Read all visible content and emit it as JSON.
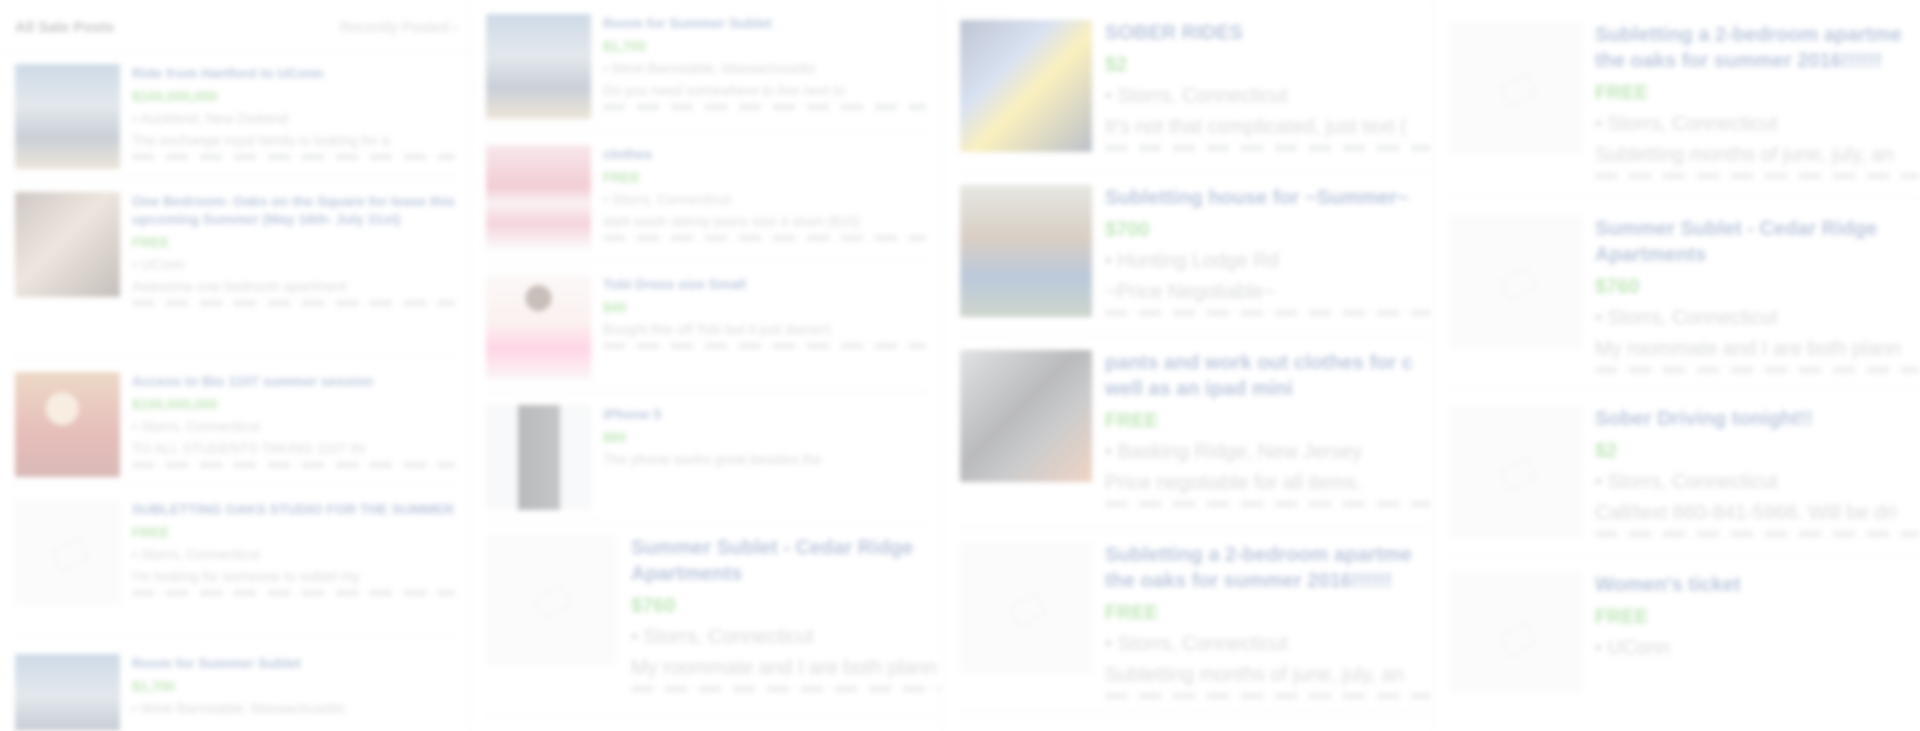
{
  "header": {
    "title": "All Sale Posts",
    "sort_label": "Recently Posted ›"
  },
  "columns": [
    {
      "posts": [
        {
          "title": "Ride from Hartford to UConn",
          "price": "$100,000,000",
          "location": "• Auckland, New Zealand",
          "description": "The exchange royal family is looking for a",
          "image": "img-people"
        },
        {
          "title": "One Bedroom- Oaks on the Square for lease this upcoming Summer (May 16th- July 31st)",
          "price": "FREE",
          "location": "• UConn",
          "description": "Awesome one bedroom apartment",
          "image": "img-room"
        },
        {
          "title": "Access to Bio 1107 summer session",
          "price": "$100,000,000",
          "location": "• Storrs, Connecticut",
          "description": "TO ALL STUDENTS TAKING 1107 IN",
          "image": "img-man"
        },
        {
          "title": "SUBLETTING OAKS STUDIO FOR THE SUMMER",
          "price": "FREE",
          "location": "• Storrs, Connecticut",
          "description": "I'm looking for someone to sublet my",
          "image": ""
        },
        {
          "title": "Room for Summer Sublet",
          "price": "$1,700",
          "location": "• West Barnstable, Massachusetts",
          "description": "",
          "image": "img-people"
        }
      ]
    },
    {
      "posts": [
        {
          "title": "Room for Summer Sublet",
          "price": "$1,700",
          "location": "• West Barnstable, Massachusetts",
          "description": "Do you need somewhere to live next to",
          "image": "img-people"
        },
        {
          "title": "clothes",
          "price": "FREE",
          "location": "• Storrs, Connecticut",
          "description": "dark wash skinny jeans size 4 short ($10)",
          "image": "img-sweater"
        },
        {
          "title": "Tobi Dress size Small",
          "price": "$40",
          "location": "",
          "description": "Bought this off Tobi but it just doesn't",
          "image": "img-dress"
        },
        {
          "title": "iPhone 5",
          "price": "$80",
          "location": "",
          "description": "The phone works great besides the",
          "image": "img-phone"
        },
        {
          "title": "Summer Sublet - Cedar Ridge Apartments",
          "price": "$760",
          "location": "• Storrs, Connecticut",
          "description": "My roommate and I are both plann",
          "image": ""
        }
      ]
    },
    {
      "posts": [
        {
          "title": "SOBER RIDES",
          "price": "$2",
          "location": "• Storrs, Connecticut",
          "description": "It's not that complicated, just text (",
          "image": "img-car"
        },
        {
          "title": "Subletting house for ~Summer~",
          "price": "$700",
          "location": "• Hunting Lodge Rd",
          "description": "~Price Negotiable~",
          "image": "img-house"
        },
        {
          "title": "pants and work out clothes for c well as an ipad mini",
          "price": "FREE",
          "location": "• Basking Ridge, New Jersey",
          "description": "Price negotiable for all items.",
          "image": "img-ipad"
        },
        {
          "title": "Subletting a 2-bedroom apartme the oaks for summer 2016!!!!!!",
          "price": "FREE",
          "location": "• Storrs, Connecticut",
          "description": "Subletting months of june, july, an",
          "image": ""
        }
      ]
    },
    {
      "posts": [
        {
          "title": "Subletting a 2-bedroom apartme the oaks for summer 2016!!!!!!",
          "price": "FREE",
          "location": "• Storrs, Connecticut",
          "description": "Subletting months of june, july, an",
          "image": ""
        },
        {
          "title": "Summer Sublet - Cedar Ridge Apartments",
          "price": "$760",
          "location": "• Storrs, Connecticut",
          "description": "My roommate and I are both plann",
          "image": ""
        },
        {
          "title": "Sober Driving tonight!!",
          "price": "$2",
          "location": "• Storrs, Connecticut",
          "description": "Call/text 860-841-5966. Will be dri",
          "image": ""
        },
        {
          "title": "Women's ticket",
          "price": "FREE",
          "location": "• UConn",
          "description": "",
          "image": ""
        }
      ]
    }
  ],
  "colors": {
    "title": "#365899",
    "price": "#42b72a",
    "meta": "#90949c",
    "divider": "#e6e9ee"
  }
}
